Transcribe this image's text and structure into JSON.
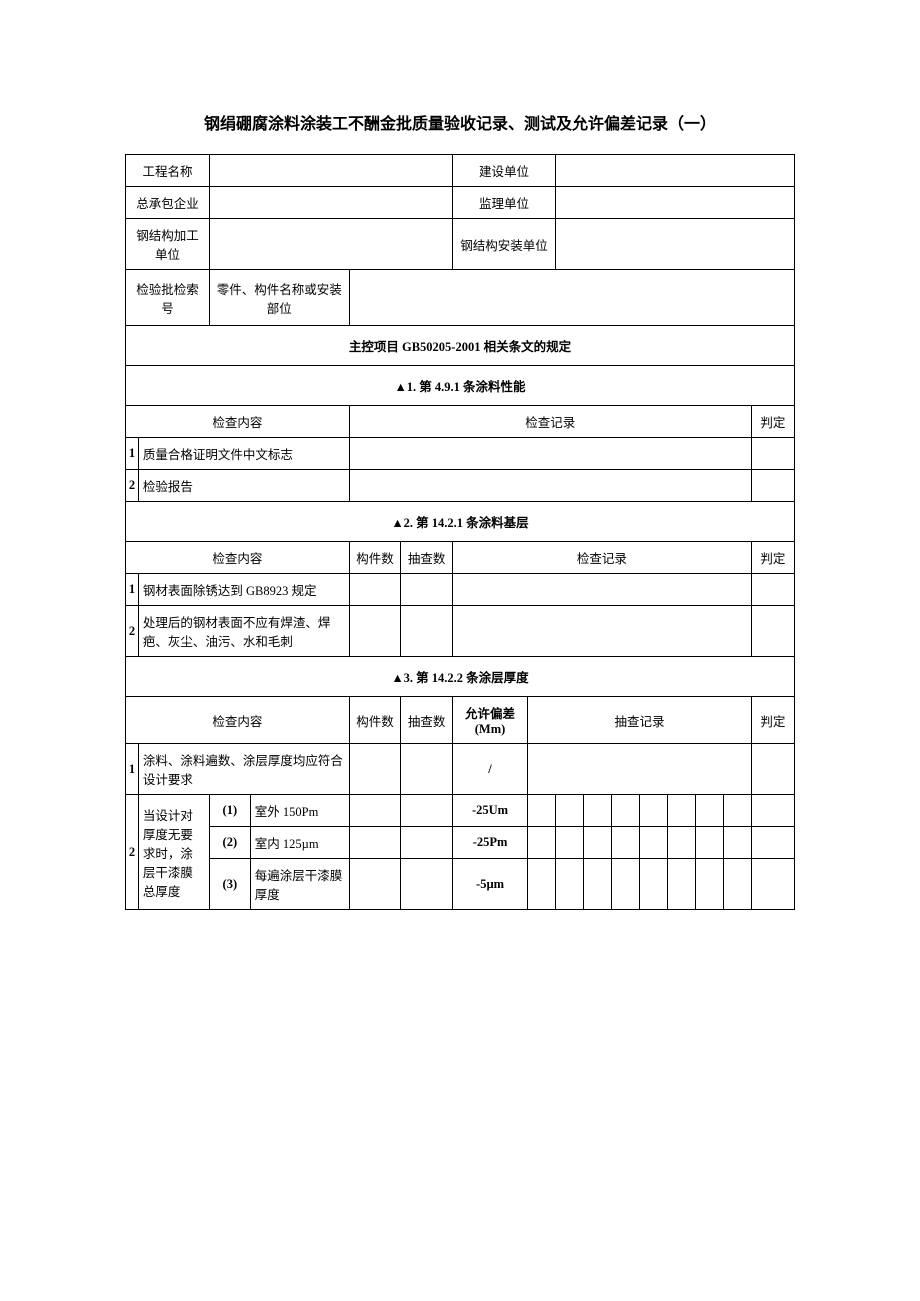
{
  "title": "钢绢硼腐涂料涂装工不酬金批质量验收记录、测试及允许偏差记录（一）",
  "header": {
    "projectNameLabel": "工程名称",
    "constructorLabel": "建设单位",
    "generalContractorLabel": "总承包企业",
    "supervisorLabel": "监理单位",
    "steelProcessorLabel": "钢结构加工单位",
    "steelInstallerLabel": "钢结构安装单位",
    "batchIndexLabel": "检验批检索号",
    "partNameLabel": "零件、构件名称或安装部位"
  },
  "mainControl": "主控项目 GB50205-2001 相关条文的规定",
  "s1": {
    "title": "▲1. 第 4.9.1 条涂料性能",
    "checkContentLabel": "检查内容",
    "checkRecordLabel": "检查记录",
    "judgeLabel": "判定",
    "row1No": "1",
    "row1Content": "质量合格证明文件中文标志",
    "row2No": "2",
    "row2Content": "检验报告"
  },
  "s2": {
    "title": "▲2. 第 14.2.1 条涂料基层",
    "checkContentLabel": "检查内容",
    "componentCountLabel": "构件数",
    "sampleCountLabel": "抽查数",
    "checkRecordLabel": "检查记录",
    "judgeLabel": "判定",
    "row1No": "1",
    "row1Content": "钢材表面除锈达到 GB8923 规定",
    "row2No": "2",
    "row2Content": "处理后的钢材表面不应有焊渣、焊疤、灰尘、油污、水和毛刺"
  },
  "s3": {
    "title": "▲3. 第 14.2.2 条涂层厚度",
    "checkContentLabel": "检查内容",
    "componentCountLabel": "构件数",
    "sampleCountLabel": "抽查数",
    "allowDevLabel": "允许偏差(Mm)",
    "sampleRecordLabel": "抽查记录",
    "judgeLabel": "判定",
    "row1No": "1",
    "row1Content": "涂料、涂料遍数、涂层厚度均应符合设计要求",
    "row1Dev": "/",
    "row2No": "2",
    "row2GroupLabel": "当设计对厚度无要求时，涂层干漆膜总厚度",
    "sub1No": "(1)",
    "sub1Content": "室外 150Pm",
    "sub1Dev": "-25Um",
    "sub2No": "(2)",
    "sub2Content": "室内 125µm",
    "sub2Dev": "-25Pm",
    "sub3No": "(3)",
    "sub3Content": "每遍涂层干漆膜厚度",
    "sub3Dev": "-5µm"
  }
}
